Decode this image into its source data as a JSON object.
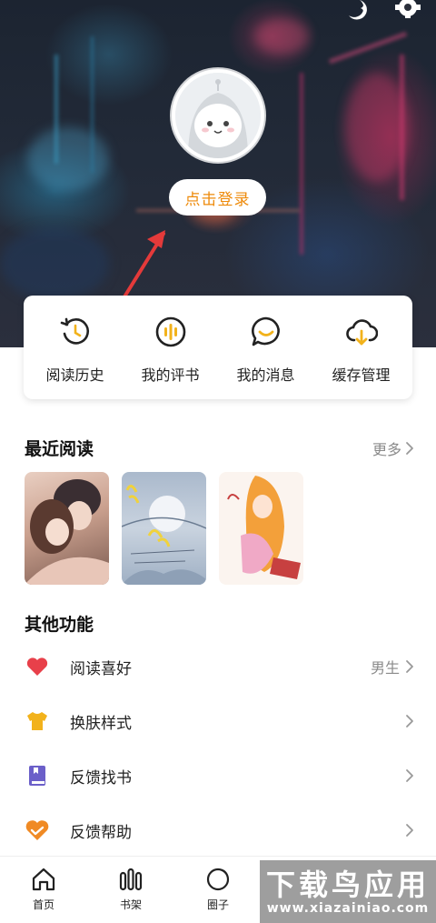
{
  "header": {
    "login_label": "点击登录",
    "icons": [
      "moon-icon",
      "gear-icon"
    ]
  },
  "quick_actions": [
    {
      "label": "阅读历史",
      "icon": "history-clock-icon"
    },
    {
      "label": "我的评书",
      "icon": "audio-bars-icon"
    },
    {
      "label": "我的消息",
      "icon": "message-bubble-icon"
    },
    {
      "label": "缓存管理",
      "icon": "cloud-download-icon"
    }
  ],
  "recent": {
    "title": "最近阅读",
    "more_label": "更多"
  },
  "other": {
    "title": "其他功能",
    "items": [
      {
        "label": "阅读喜好",
        "value": "男生",
        "icon": "heart-icon",
        "color": "#e8404a"
      },
      {
        "label": "换肤样式",
        "value": "",
        "icon": "tshirt-icon",
        "color": "#f2b21b"
      },
      {
        "label": "反馈找书",
        "value": "",
        "icon": "book-icon",
        "color": "#6b5fc9"
      },
      {
        "label": "反馈帮助",
        "value": "",
        "icon": "help-handshake-icon",
        "color": "#f08a24"
      }
    ]
  },
  "tabbar": {
    "tabs": [
      {
        "label": "首页",
        "icon": "home-icon"
      },
      {
        "label": "书架",
        "icon": "bookshelf-icon"
      },
      {
        "label": "圈子",
        "icon": "circle-icon"
      }
    ]
  },
  "watermark": {
    "title": "下载鸟应用",
    "url": "www.xiazainiao.com"
  },
  "colors": {
    "accent": "#f2b21b",
    "login_text": "#ee8a0a",
    "annotation_arrow": "#e43a3a"
  }
}
